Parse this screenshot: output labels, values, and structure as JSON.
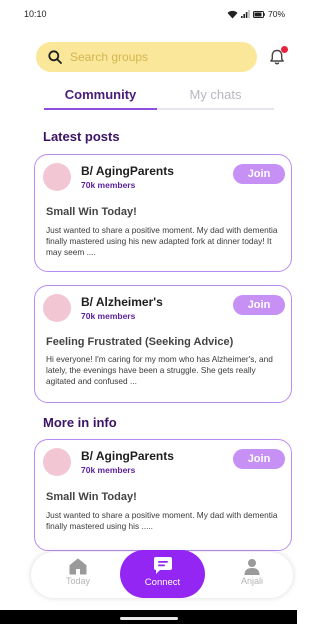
{
  "status": {
    "time": "10:10",
    "battery": "70%"
  },
  "search": {
    "placeholder": "Search groups"
  },
  "tabs": [
    {
      "label": "Community",
      "active": true
    },
    {
      "label": "My chats",
      "active": false
    }
  ],
  "sections": {
    "latest": "Latest posts",
    "more": "More in info"
  },
  "posts": [
    {
      "group": "B/ AgingParents",
      "members": "70k members",
      "join": "Join",
      "title": "Small Win Today!",
      "body": "Just wanted to share a positive moment. My dad with dementia finally mastered using his new adapted fork at dinner today! It may seem ...."
    },
    {
      "group": "B/ Alzheimer's",
      "members": "70k members",
      "join": "Join",
      "title": "Feeling Frustrated (Seeking Advice)",
      "body": "Hi everyone! I'm caring for my mom who has Alzheimer's, and lately, the evenings have been a struggle. She gets really agitated and confused ..."
    },
    {
      "group": "B/ AgingParents",
      "members": "70k members",
      "join": "Join",
      "title": "Small Win Today!",
      "body": "Just wanted to share a positive moment. My dad with dementia finally mastered using his ....."
    }
  ],
  "nav": {
    "today": "Today",
    "connect": "Connect",
    "profile": "Anjali"
  },
  "colors": {
    "accent": "#9326f2",
    "join": "#c690f5",
    "card_border": "#b98cf3",
    "search_bg": "#fbe79a",
    "notification_dot": "#e8243d"
  }
}
